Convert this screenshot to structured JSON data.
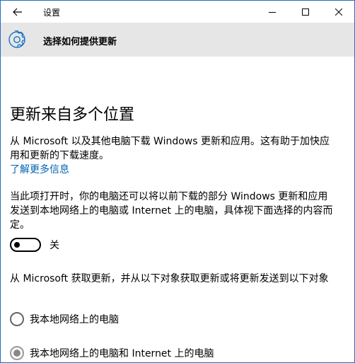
{
  "window": {
    "title": "设置"
  },
  "header": {
    "title": "选择如何提供更新",
    "icon": "gear-icon"
  },
  "main": {
    "heading": "更新来自多个位置",
    "description": "从 Microsoft 以及其他电脑下载 Windows 更新和应用。这有助于加快应用和更新的下载速度。",
    "learn_more_link": "了解更多信息",
    "toggle_description": "当此项打开时，你的电脑还可以将以前下载的部分 Windows 更新和应用发送到本地网络上的电脑或 Internet 上的电脑，具体视下面选择的内容而定。",
    "toggle": {
      "state_label": "关",
      "on": false
    },
    "source_description": "从 Microsoft 获取更新，并从以下对象获取更新或将更新发送到以下对象",
    "options": [
      {
        "label": "我本地网络上的电脑",
        "selected": false
      },
      {
        "label": "我本地网络上的电脑和 Internet 上的电脑",
        "selected": true
      }
    ]
  },
  "colors": {
    "accent": "#0063b1",
    "header_bg": "#e6e6e6",
    "window_border": "#1f6fc5"
  }
}
